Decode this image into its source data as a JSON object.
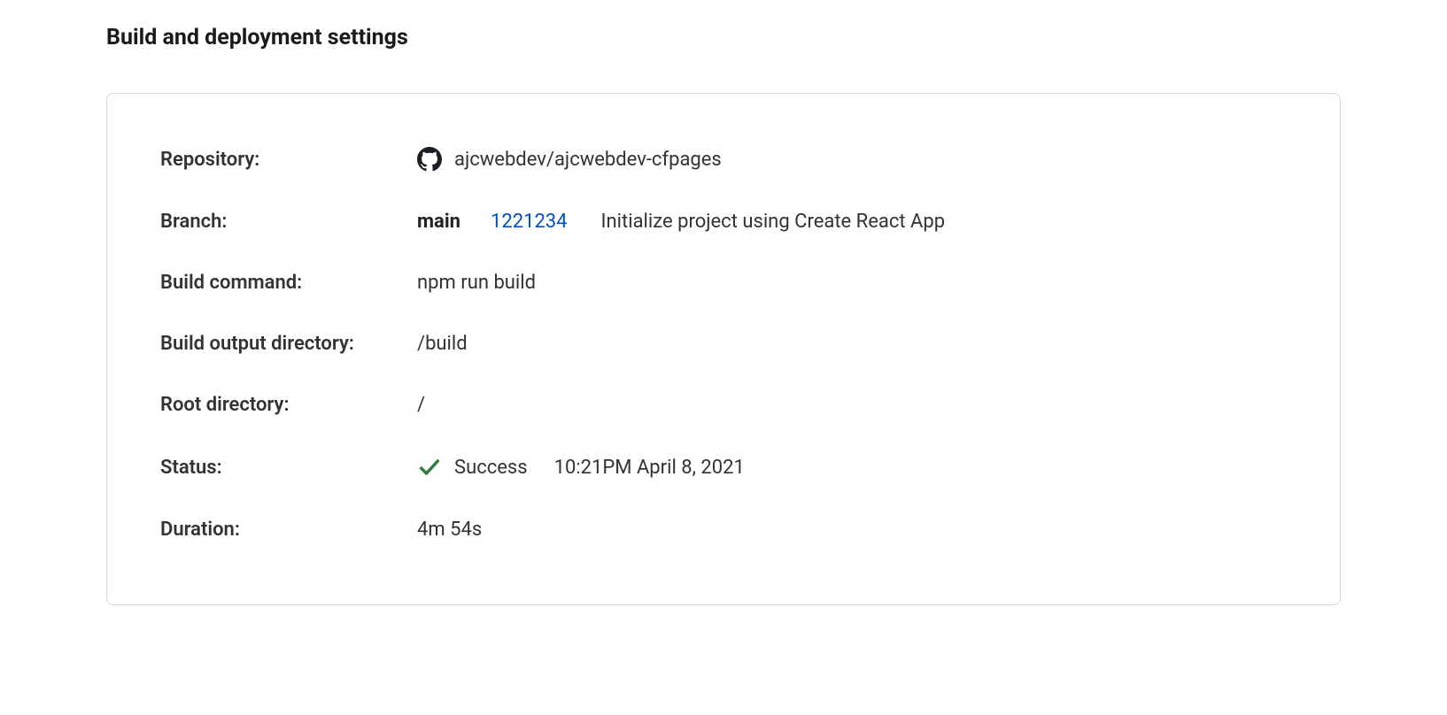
{
  "section": {
    "title": "Build and deployment settings"
  },
  "labels": {
    "repository": "Repository:",
    "branch": "Branch:",
    "build_command": "Build command:",
    "build_output_directory": "Build output directory:",
    "root_directory": "Root directory:",
    "status": "Status:",
    "duration": "Duration:"
  },
  "values": {
    "repository": "ajcwebdev/ajcwebdev-cfpages",
    "branch": "main",
    "commit_hash": "1221234",
    "commit_message": "Initialize project using Create React App",
    "build_command": "npm run build",
    "build_output_directory": "/build",
    "root_directory": "/",
    "status": "Success",
    "status_timestamp": "10:21PM April 8, 2021",
    "duration": "4m 54s"
  },
  "colors": {
    "link": "#0051c3",
    "success": "#2f7d3b"
  }
}
